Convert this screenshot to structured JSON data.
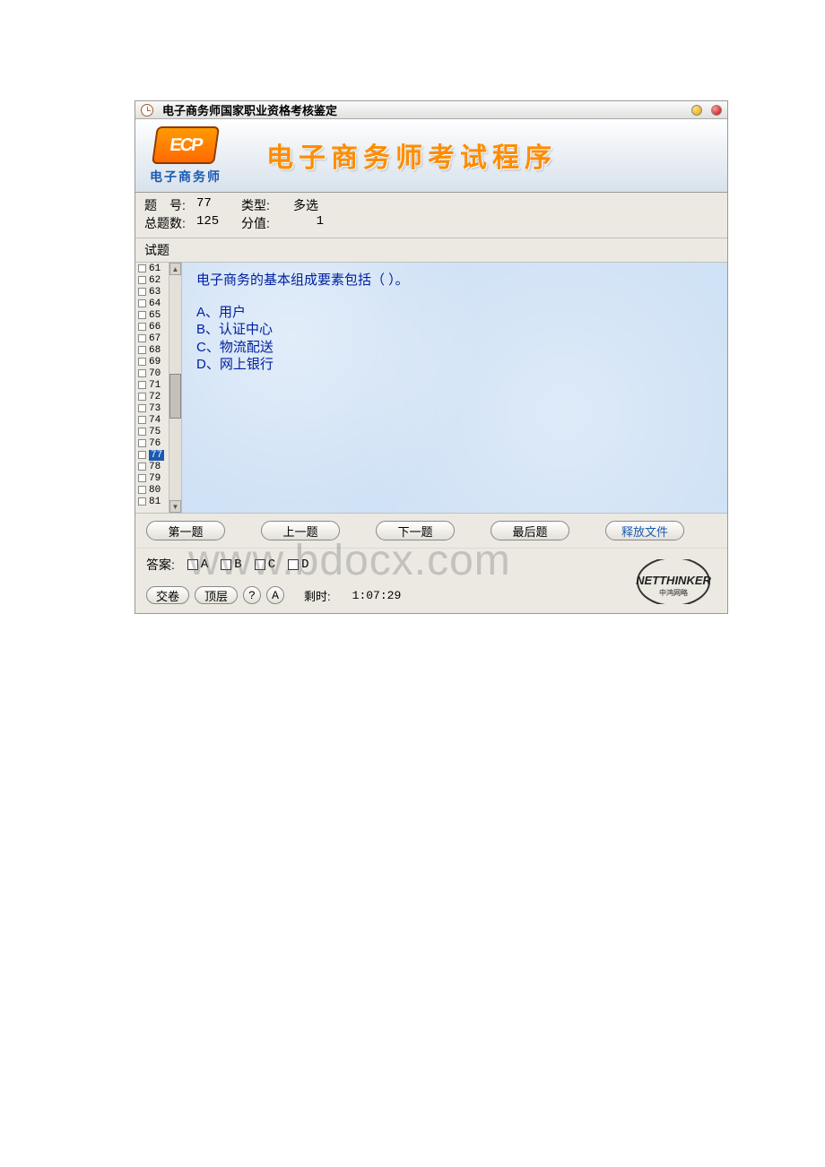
{
  "window": {
    "title": "电子商务师国家职业资格考核鉴定"
  },
  "banner": {
    "logo_text": "ECP",
    "logo_sub": "电子商务师",
    "title": "电子商务师考试程序"
  },
  "info": {
    "qnum_label": "题　号:",
    "qnum_value": "77",
    "type_label": "类型:",
    "type_value": "多选",
    "total_label": "总题数:",
    "total_value": "125",
    "score_label": "分值:",
    "score_value": "1"
  },
  "section": {
    "label": "试题"
  },
  "question_list": {
    "start": 61,
    "end": 81,
    "selected": 77
  },
  "question": {
    "stem": "电子商务的基本组成要素包括（ ）。",
    "options": [
      "A、用户",
      "B、认证中心",
      "C、物流配送",
      "D、网上银行"
    ]
  },
  "nav": {
    "first": "第一题",
    "prev": "上一题",
    "next": "下一题",
    "last": "最后题",
    "release": "释放文件"
  },
  "answer": {
    "label": "答案:",
    "choices": [
      "A",
      "B",
      "C",
      "D"
    ]
  },
  "bottom": {
    "submit": "交卷",
    "top": "顶层",
    "help": "?",
    "a_btn": "A",
    "time_label": "剩时:",
    "time_value": "1:07:29"
  },
  "brand": {
    "name": "NETTHINKER",
    "sub": "中鸿网略"
  },
  "watermark": "www.bdocx.com"
}
